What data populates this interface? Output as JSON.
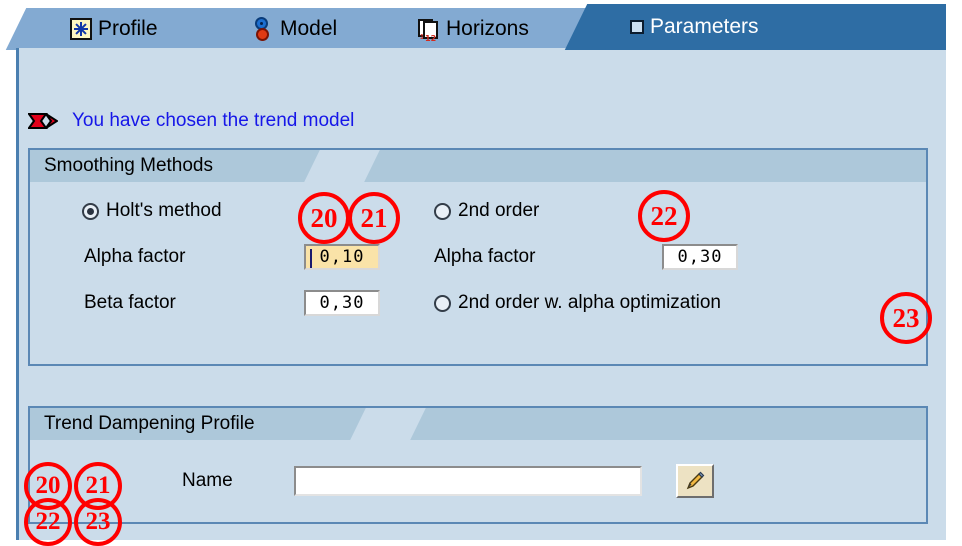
{
  "tabs": [
    {
      "label": "Profile",
      "icon": "profile-starburst-icon",
      "active": false
    },
    {
      "label": "Model",
      "icon": "gears-icon",
      "active": false
    },
    {
      "label": "Horizons",
      "icon": "calendar-icon",
      "active": false
    },
    {
      "label": "Parameters",
      "icon": "square-icon",
      "active": true
    }
  ],
  "message": {
    "icon": "red-arrow-icon",
    "text": "You have chosen the trend model"
  },
  "smoothing_group": {
    "title": "Smoothing Methods",
    "holts_radio": {
      "label": "Holt's method",
      "selected": true
    },
    "second_order_radio": {
      "label": "2nd order",
      "selected": false
    },
    "second_order_alpha_radio": {
      "label": "2nd order w. alpha optimization",
      "selected": false
    },
    "alpha_left": {
      "label": "Alpha factor",
      "value": "0,10",
      "focused": true
    },
    "beta_left": {
      "label": "Beta factor",
      "value": "0,30",
      "focused": false
    },
    "alpha_right": {
      "label": "Alpha factor",
      "value": "0,30",
      "focused": false
    }
  },
  "trend_group": {
    "title": "Trend Dampening Profile",
    "name_label": "Name",
    "name_value": "",
    "name_placeholder": "",
    "edit_button_icon": "pencil-icon"
  },
  "annotations": [
    {
      "id": "ann-20-top",
      "label": "20"
    },
    {
      "id": "ann-21-top",
      "label": "21"
    },
    {
      "id": "ann-22-top",
      "label": "22"
    },
    {
      "id": "ann-23-right",
      "label": "23"
    },
    {
      "id": "ann-20-bottom",
      "label": "20"
    },
    {
      "id": "ann-21-bottom",
      "label": "21"
    },
    {
      "id": "ann-22-bottom",
      "label": "22"
    },
    {
      "id": "ann-23-bottom",
      "label": "23"
    }
  ],
  "colors": {
    "panel_bg": "#CBDCEA",
    "tab_inactive": "#83AAD2",
    "tab_active": "#2E6DA4",
    "group_header": "#ADC8DA",
    "group_border": "#5B88B5",
    "message_text": "#1616E8",
    "annotation": "#FF0000",
    "focused_field": "#FAE3A8"
  }
}
